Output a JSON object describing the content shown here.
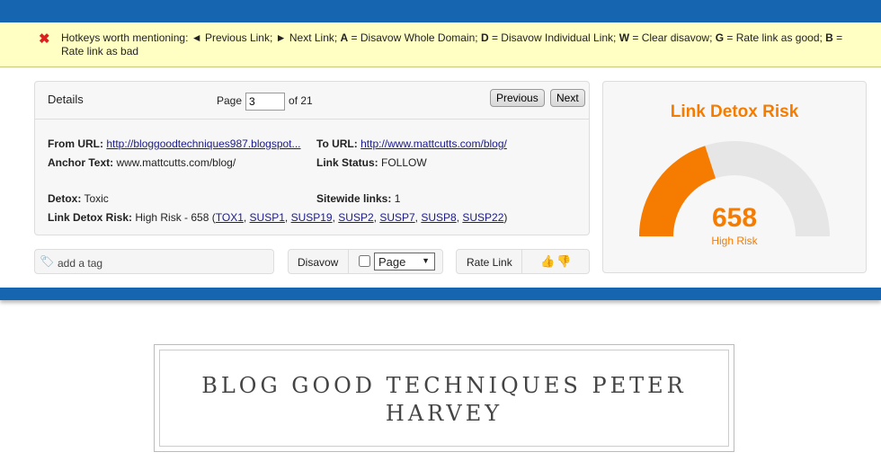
{
  "hotkeys": {
    "icon": "close-icon",
    "text_parts": [
      "Hotkeys worth mentioning: ◄ Previous Link; ► Next Link; ",
      "A",
      " = Disavow Whole Domain; ",
      "D",
      " = Disavow Individual Link; ",
      "W",
      " = Clear disavow; ",
      "G",
      " = Rate link as good; ",
      "B",
      " = Rate link as bad"
    ]
  },
  "details": {
    "title": "Details",
    "page_label": "Page",
    "page_value": "3",
    "page_of": "of 21",
    "previous": "Previous",
    "next": "Next",
    "from_url_label": "From URL:",
    "from_url": "http://bloggoodtechniques987.blogspot...",
    "to_url_label": "To URL:",
    "to_url": "http://www.mattcutts.com/blog/",
    "anchor_label": "Anchor Text:",
    "anchor": "www.mattcutts.com/blog/",
    "status_label": "Link Status:",
    "status": "FOLLOW",
    "detox_label": "Detox:",
    "detox": "Toxic",
    "sitewide_label": "Sitewide links:",
    "sitewide": "1",
    "risk_label": "Link Detox Risk:",
    "risk_text": "High Risk - 658 (",
    "risk_close": ")",
    "risk_codes": [
      "TOX1",
      "SUSP1",
      "SUSP19",
      "SUSP2",
      "SUSP7",
      "SUSP8",
      "SUSP22"
    ]
  },
  "actions": {
    "tag_placeholder": "add a tag",
    "disavow": "Disavow",
    "disavow_select": "Page",
    "rate": "Rate Link"
  },
  "gauge": {
    "title": "Link Detox Risk",
    "value": "658",
    "label": "High Risk",
    "fill_fraction": 0.4,
    "color": "#f57c00"
  },
  "blog": {
    "title": "BLOG GOOD TECHNIQUES PETER HARVEY"
  }
}
